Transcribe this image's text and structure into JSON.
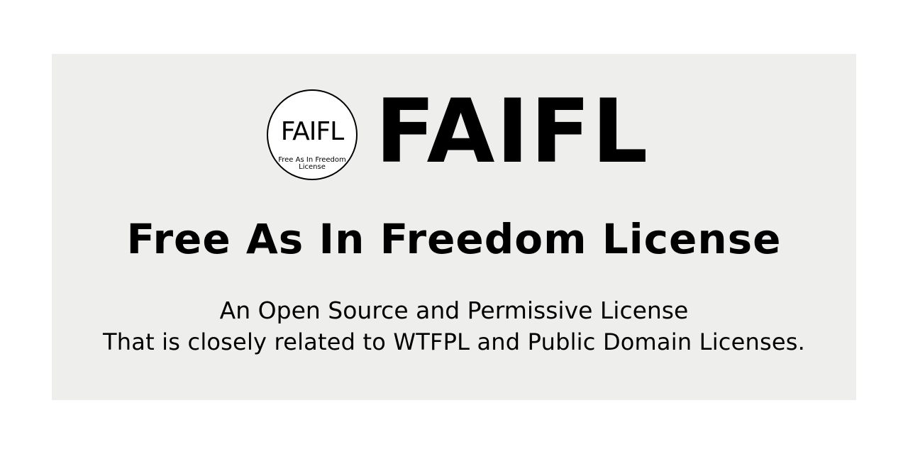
{
  "seal": {
    "title": "FAIFL",
    "caption_line1": "Free As In Freedom",
    "caption_line2": "License"
  },
  "banner": {
    "title": "FAIFL",
    "subtitle": "Free As In Freedom License",
    "description_line1": "An Open Source and Permissive License",
    "description_line2": "That is closely related to WTFPL and Public Domain Licenses."
  },
  "colors": {
    "panel_background": "#eeeeed",
    "page_background": "#ffffff",
    "text": "#000000"
  }
}
